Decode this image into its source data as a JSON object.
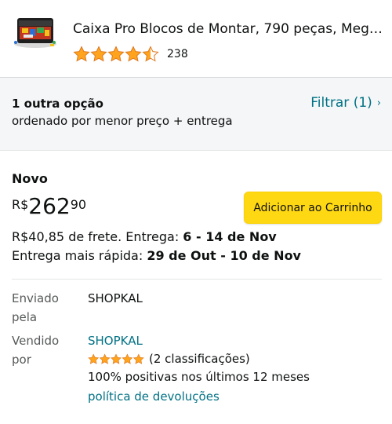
{
  "product": {
    "title": "Caixa Pro Blocos de Montar, 790 peças, Mega…",
    "rating_count": "238",
    "star_rating": 4.5,
    "thumbnail_icon": "toy-box-thumbnail"
  },
  "filters": {
    "other_options": "1 outra opção",
    "sort_text": "ordenado por menor preço + entrega",
    "filter_label": "Filtrar (1)",
    "chevron": "›"
  },
  "offer": {
    "condition": "Novo",
    "price_currency": "R$",
    "price_whole": "262",
    "price_fraction": "90",
    "add_to_cart": "Adicionar ao Carrinho",
    "shipping_prefix": "R$40,85 de frete. Entrega: ",
    "shipping_dates": "6 - 14 de Nov",
    "fastest_prefix": "Entrega mais rápida: ",
    "fastest_dates": "29 de Out - 10 de Nov",
    "shipped_by_label": "Enviado pela",
    "shipped_by_value": "SHOPKAL",
    "sold_by_label": "Vendido por",
    "sold_by_value": "SHOPKAL",
    "seller_ratings": "(2 classificações)",
    "seller_star_rating": 5,
    "seller_positive": "100% positivas nos últimos 12 meses",
    "returns_link": "política de devoluções"
  },
  "colors": {
    "link": "#007185",
    "star": "#ffa41c",
    "button": "#ffd814",
    "band": "#f4f6f7"
  }
}
